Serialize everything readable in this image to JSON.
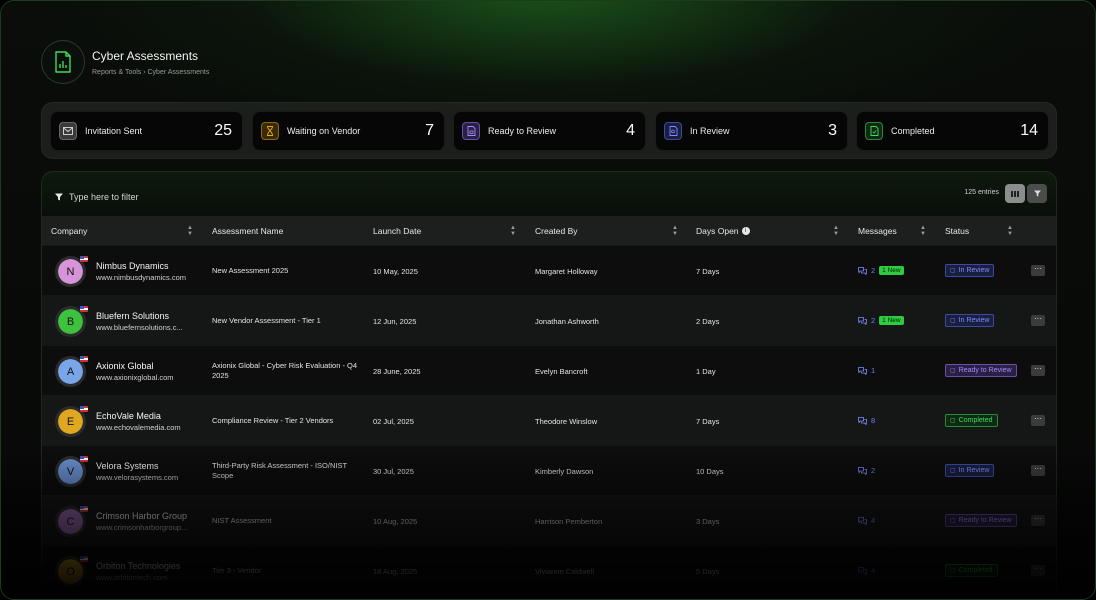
{
  "header": {
    "title": "Cyber Assessments",
    "breadcrumb": "Reports & Tools › Cyber Assessments",
    "icon": "chart-document-icon"
  },
  "stats": [
    {
      "label": "Invitation Sent",
      "value": "25",
      "icon": "mail-icon",
      "color": "#8a8a8a"
    },
    {
      "label": "Waiting on Vendor",
      "value": "7",
      "icon": "hourglass-icon",
      "color": "#d4a020"
    },
    {
      "label": "Ready to Review",
      "value": "4",
      "icon": "lock-file-icon",
      "color": "#a78bfa"
    },
    {
      "label": "In Review",
      "value": "3",
      "icon": "search-file-icon",
      "color": "#7d8cff"
    },
    {
      "label": "Completed",
      "value": "14",
      "icon": "check-file-icon",
      "color": "#3ddc5a"
    }
  ],
  "table": {
    "filter_placeholder": "Type here to filter",
    "entries": "125 entries",
    "columns": [
      "Company",
      "Assessment Name",
      "Launch Date",
      "Created By",
      "Days Open",
      "Messages",
      "Status"
    ],
    "rows": [
      {
        "initial": "N",
        "avatar_color": "#d894d8",
        "company": "Nimbus Dynamics",
        "url": "www.nimbusdynamics.com",
        "assessment": "New Assessment 2025",
        "launch": "10 May, 2025",
        "created_by": "Margaret Holloway",
        "days": "7 Days",
        "messages": "2",
        "new": "1 New",
        "status": "In Review",
        "status_type": "review"
      },
      {
        "initial": "B",
        "avatar_color": "#3ec23e",
        "company": "Bluefern Solutions",
        "url": "www.bluefernsolutions.c...",
        "assessment": "New Vendor Assessment - Tier 1",
        "launch": "12 Jun, 2025",
        "created_by": "Jonathan Ashworth",
        "days": "2 Days",
        "messages": "2",
        "new": "1 New",
        "status": "In Review",
        "status_type": "review"
      },
      {
        "initial": "A",
        "avatar_color": "#79a6e8",
        "company": "Axionix Global",
        "url": "www.axionixglobal.com",
        "assessment": "Axionix Global - Cyber Risk Evaluation - Q4 2025",
        "launch": "28 June, 2025",
        "created_by": "Evelyn Bancroft",
        "days": "1 Day",
        "messages": "1",
        "new": "",
        "status": "Ready to Review",
        "status_type": "ready"
      },
      {
        "initial": "E",
        "avatar_color": "#e0a820",
        "company": "EchoVale Media",
        "url": "www.echovalemedia.com",
        "assessment": "Compliance Review - Tier 2 Vendors",
        "launch": "02 Jul, 2025",
        "created_by": "Theodore Winslow",
        "days": "7 Days",
        "messages": "8",
        "new": "",
        "status": "Completed",
        "status_type": "done"
      },
      {
        "initial": "V",
        "avatar_color": "#6a8fd0",
        "company": "Velora Systems",
        "url": "www.velorasystems.com",
        "assessment": "Third-Party Risk Assessment - ISO/NIST Scope",
        "launch": "30 Jul, 2025",
        "created_by": "Kimberly Dawson",
        "days": "10 Days",
        "messages": "2",
        "new": "",
        "status": "In Review",
        "status_type": "review"
      },
      {
        "initial": "C",
        "avatar_color": "#9b6ab5",
        "company": "Crimson Harbor Group",
        "url": "www.crimsonharborgroup...",
        "assessment": "NIST Assessment",
        "launch": "10 Aug, 2025",
        "created_by": "Harrison Pemberton",
        "days": "3 Days",
        "messages": "4",
        "new": "",
        "status": "Ready to Review",
        "status_type": "ready"
      },
      {
        "initial": "O",
        "avatar_color": "#d4a020",
        "company": "Orbiton Technologies",
        "url": "www.orbitontech.com",
        "assessment": "Tier 3 - Vendor",
        "launch": "18 Aug, 2025",
        "created_by": "Vivianne Caldwell",
        "days": "5 Days",
        "messages": "4",
        "new": "",
        "status": "Completed",
        "status_type": "done"
      }
    ]
  }
}
